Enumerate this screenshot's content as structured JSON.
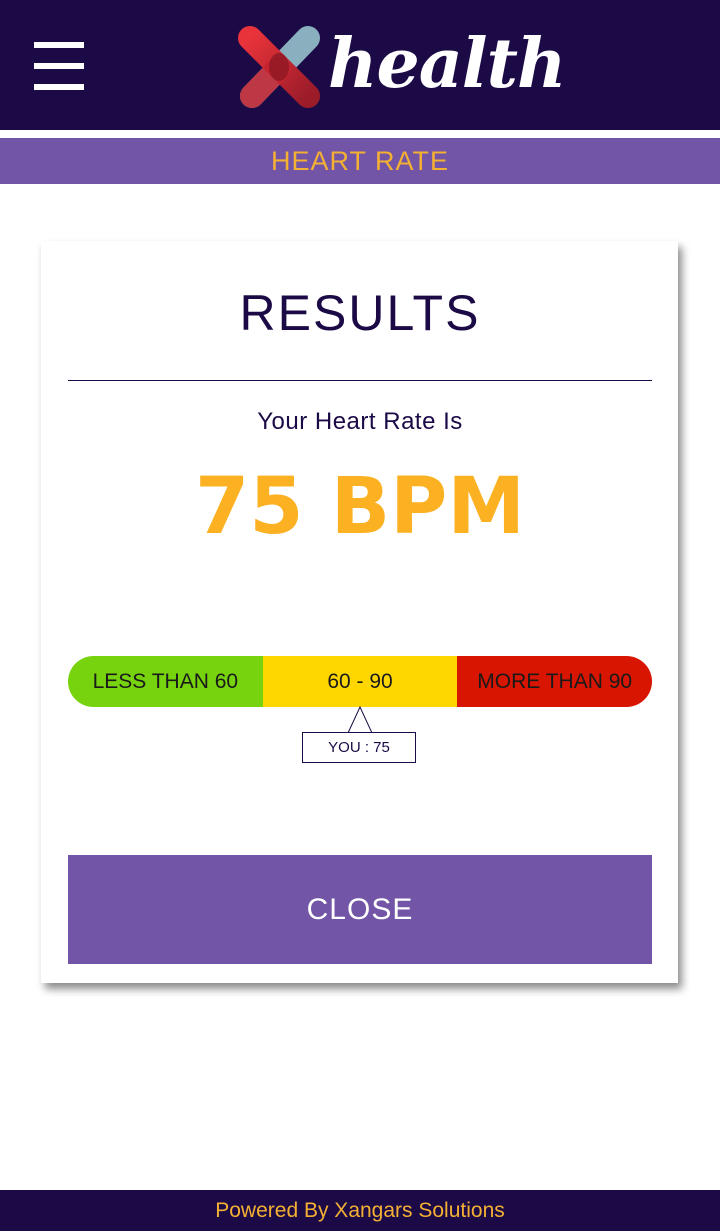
{
  "header": {
    "logo_text": "health",
    "logo_mark": "x-logo-icon",
    "menu_icon": "hamburger-menu-icon"
  },
  "subheader": {
    "title": "HEART RATE"
  },
  "results": {
    "title": "RESULTS",
    "rate_label": "Your Heart Rate Is",
    "rate_value": "75 BPM",
    "ranges": [
      {
        "label": "LESS THAN 60",
        "color": "#76d30e"
      },
      {
        "label": "60 - 90",
        "color": "#ffd700"
      },
      {
        "label": "MORE THAN 90",
        "color": "#d81500"
      }
    ],
    "you_marker": "YOU : 75",
    "close_label": "CLOSE"
  },
  "footer": {
    "text": "Powered By Xangars Solutions"
  },
  "colors": {
    "navy": "#1c0a47",
    "purple": "#7255a6",
    "accent": "#f4b033",
    "bpm": "#fbb121"
  }
}
